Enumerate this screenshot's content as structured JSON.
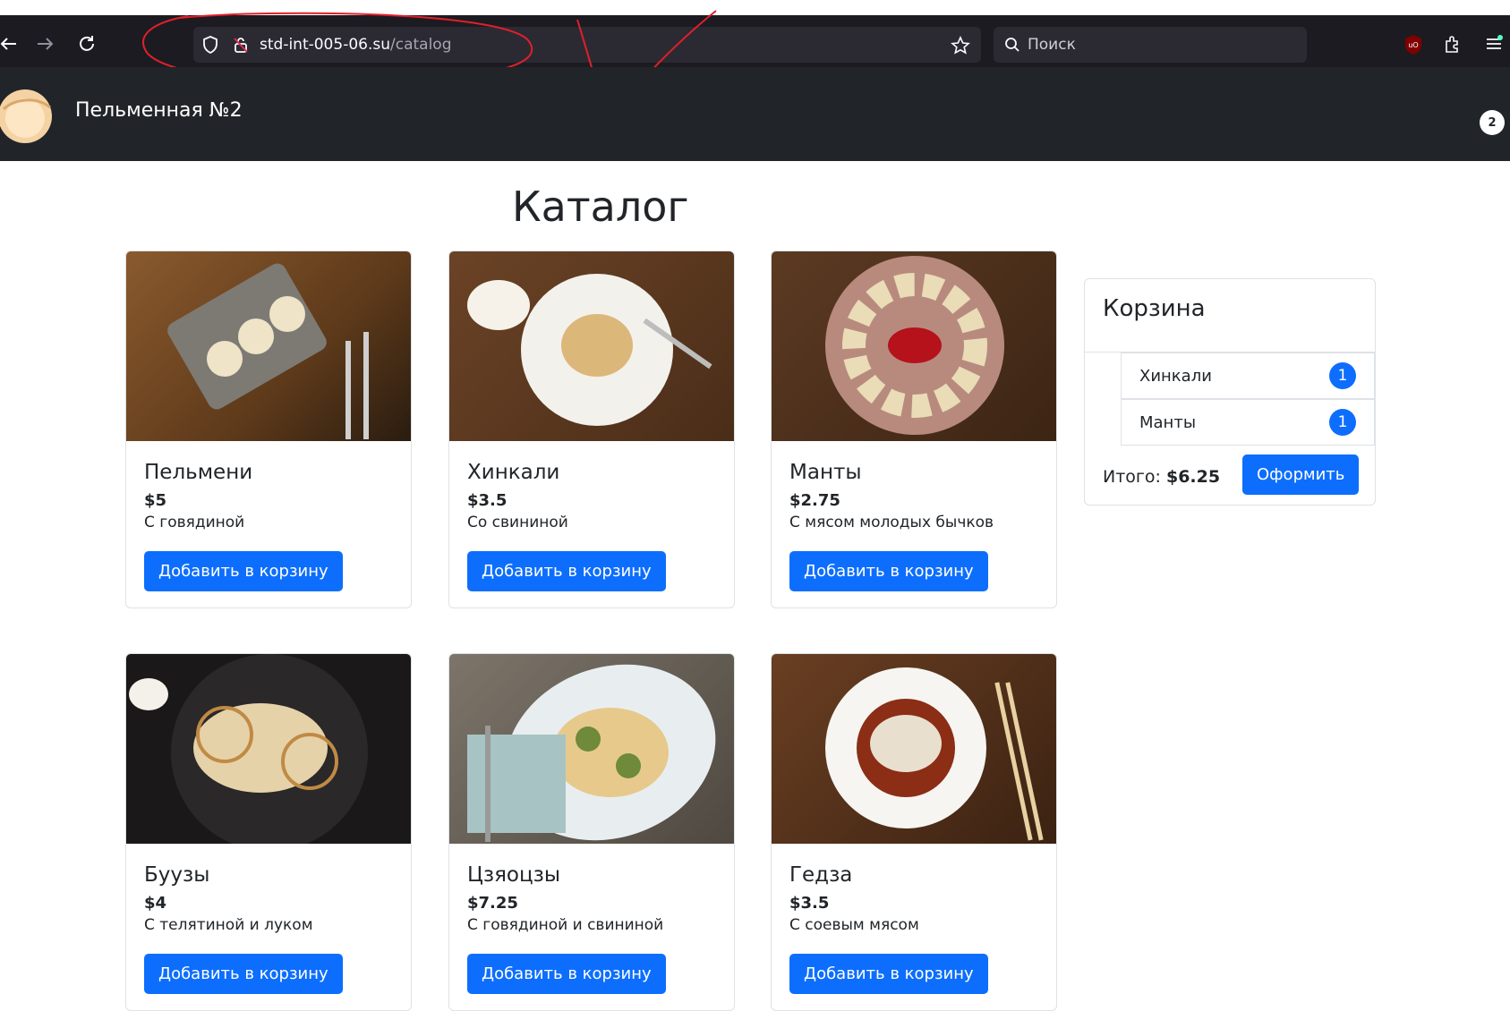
{
  "browser": {
    "url_host": "std-int-005-06.su",
    "url_path": "/catalog",
    "search_placeholder": "Поиск",
    "colors": {
      "toolbar": "#1c1b22",
      "field": "#2b2a33"
    }
  },
  "site": {
    "brand": "Пельменная №2",
    "cart_count": "2"
  },
  "catalog": {
    "title": "Каталог",
    "add_label": "Добавить в корзину",
    "products": [
      {
        "name": "Пельмени",
        "price": "$5",
        "desc": "С говядиной",
        "image": "dish-photo-pelmeni"
      },
      {
        "name": "Хинкали",
        "price": "$3.5",
        "desc": "Со свининой",
        "image": "dish-photo-khinkali"
      },
      {
        "name": "Манты",
        "price": "$2.75",
        "desc": "С мясом молодых бычков",
        "image": "dish-photo-manti"
      },
      {
        "name": "Буузы",
        "price": "$4",
        "desc": "С телятиной и луком",
        "image": "dish-photo-buuzy"
      },
      {
        "name": "Цзяоцзы",
        "price": "$7.25",
        "desc": "С говядиной и свининой",
        "image": "dish-photo-jiaozi"
      },
      {
        "name": "Гедза",
        "price": "$3.5",
        "desc": "С соевым мясом",
        "image": "dish-photo-gyoza"
      }
    ]
  },
  "cart": {
    "title": "Корзина",
    "items": [
      {
        "name": "Хинкали",
        "qty": "1"
      },
      {
        "name": "Манты",
        "qty": "1"
      }
    ],
    "total_label": "Итого:",
    "total_value": "$6.25",
    "checkout_label": "Оформить",
    "accent": "#0d6efd"
  }
}
